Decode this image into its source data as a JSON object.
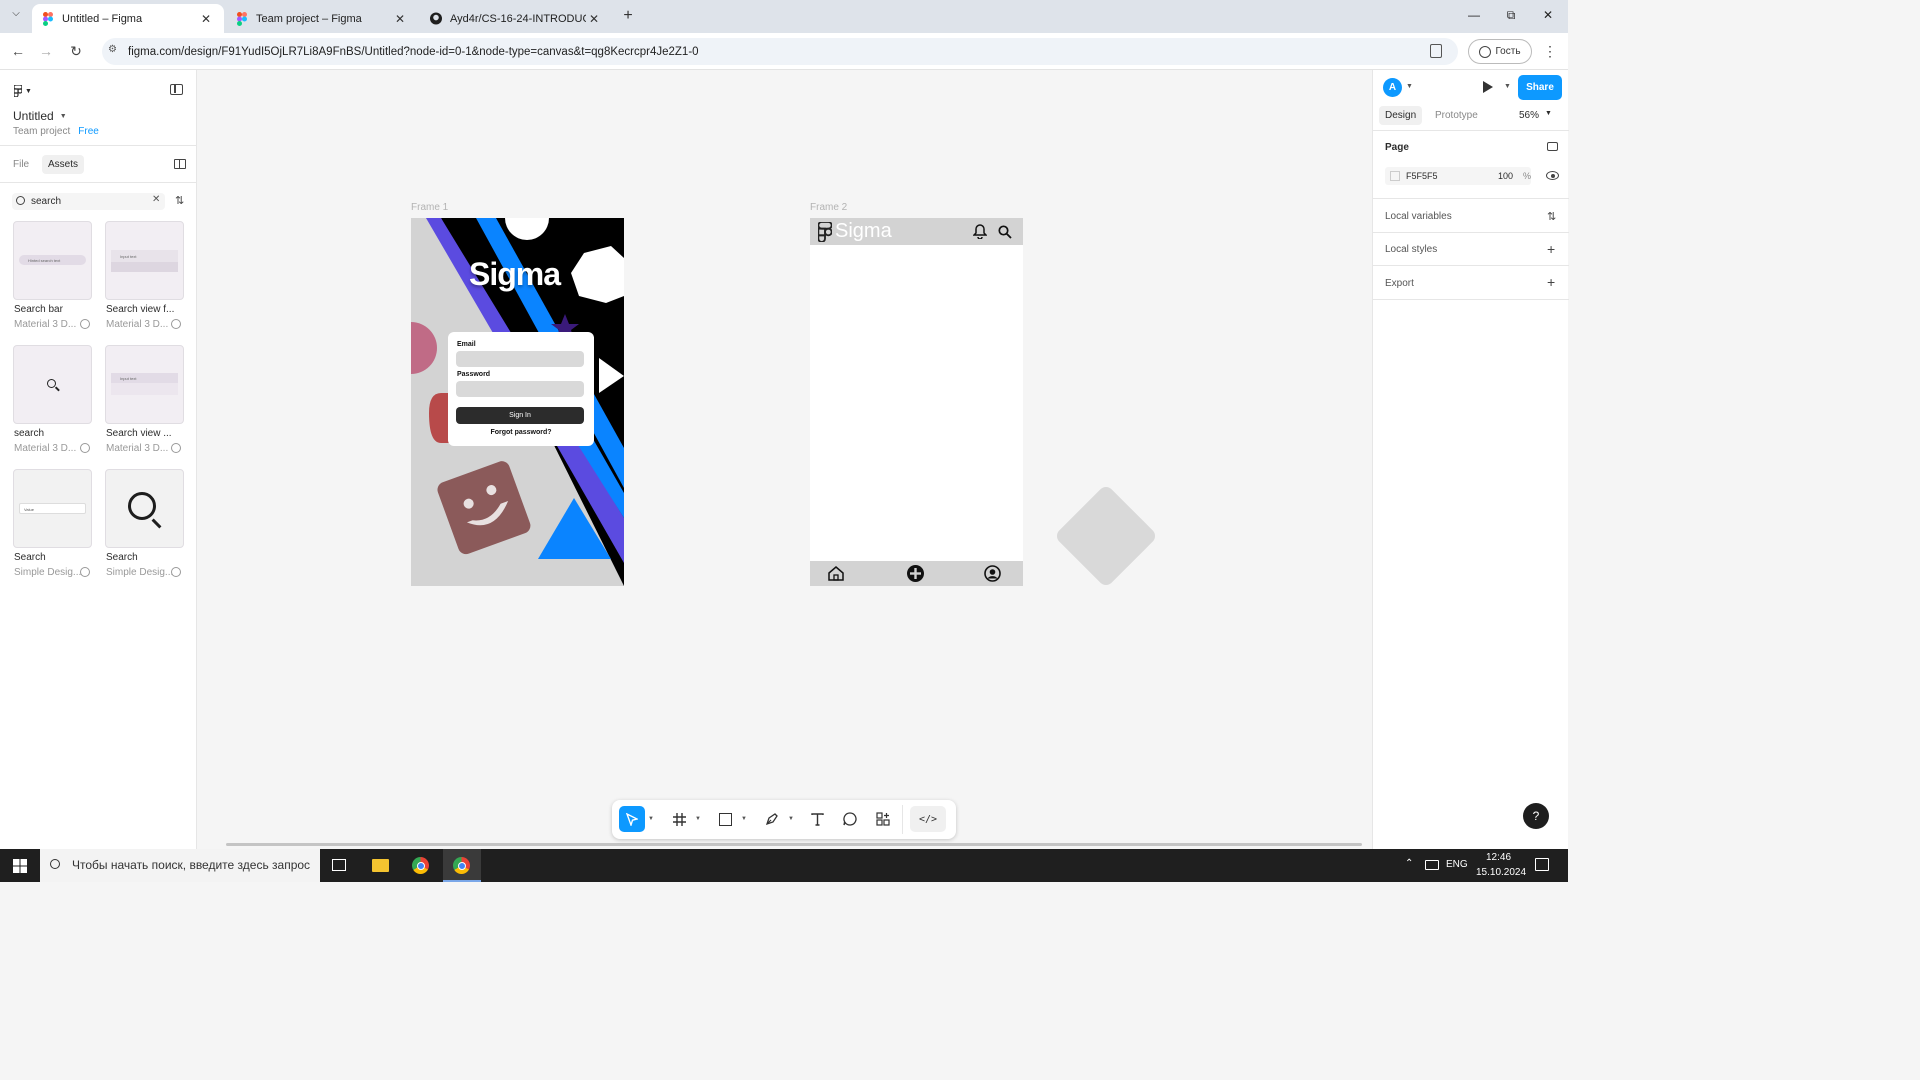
{
  "browser": {
    "tabs": [
      {
        "title": "Untitled – Figma"
      },
      {
        "title": "Team project – Figma"
      },
      {
        "title": "Ayd4r/CS-16-24-INTRODUCTIO"
      }
    ],
    "url": "figma.com/design/F91YudI5OjLR7Li8A9FnBS/Untitled?node-id=0-1&node-type=canvas&t=qg8Kecrcpr4Je2Z1-0",
    "guest_label": "Гость"
  },
  "figma": {
    "file_name": "Untitled",
    "team": "Team project",
    "plan": "Free",
    "left_tabs": [
      "File",
      "Assets"
    ],
    "search_value": "search",
    "assets": [
      {
        "name": "Search bar",
        "library": "Material 3 D..."
      },
      {
        "name": "Search view f...",
        "library": "Material 3 D..."
      },
      {
        "name": "search",
        "library": "Material 3 D..."
      },
      {
        "name": "Search view ...",
        "library": "Material 3 D..."
      },
      {
        "name": "Search",
        "library": "Simple Desig..."
      },
      {
        "name": "Search",
        "library": "Simple Desig..."
      }
    ],
    "asset_thumbs": {
      "search_bar_text": "Hinted search text",
      "search_view_text": "Input text",
      "search_view2_text": "Input text",
      "value_text": "Value"
    },
    "canvas": {
      "frame1_label": "Frame 1",
      "frame2_label": "Frame 2",
      "frame1": {
        "title": "Sigma",
        "email_label": "Email",
        "password_label": "Password",
        "signin_label": "Sign In",
        "forgot_label": "Forgot password?"
      },
      "frame2": {
        "title": "Sigma"
      }
    },
    "right": {
      "avatar_letter": "A",
      "share_label": "Share",
      "tabs": [
        "Design",
        "Prototype"
      ],
      "zoom": "56%",
      "page_label": "Page",
      "page_color": "F5F5F5",
      "page_opacity": "100",
      "percent_sign": "%",
      "local_variables": "Local variables",
      "local_styles": "Local styles",
      "export": "Export"
    },
    "help_label": "?"
  },
  "taskbar": {
    "search_placeholder": "Чтобы начать поиск, введите здесь запрос",
    "lang": "ENG",
    "time": "12:46",
    "date": "15.10.2024"
  },
  "colors": {
    "accent": "#0d99ff",
    "chrome_bg": "#dee3ea",
    "canvas_bg": "#f5f5f5",
    "frame_blue": "#0a84ff",
    "frame_purple": "#5b4be0"
  }
}
